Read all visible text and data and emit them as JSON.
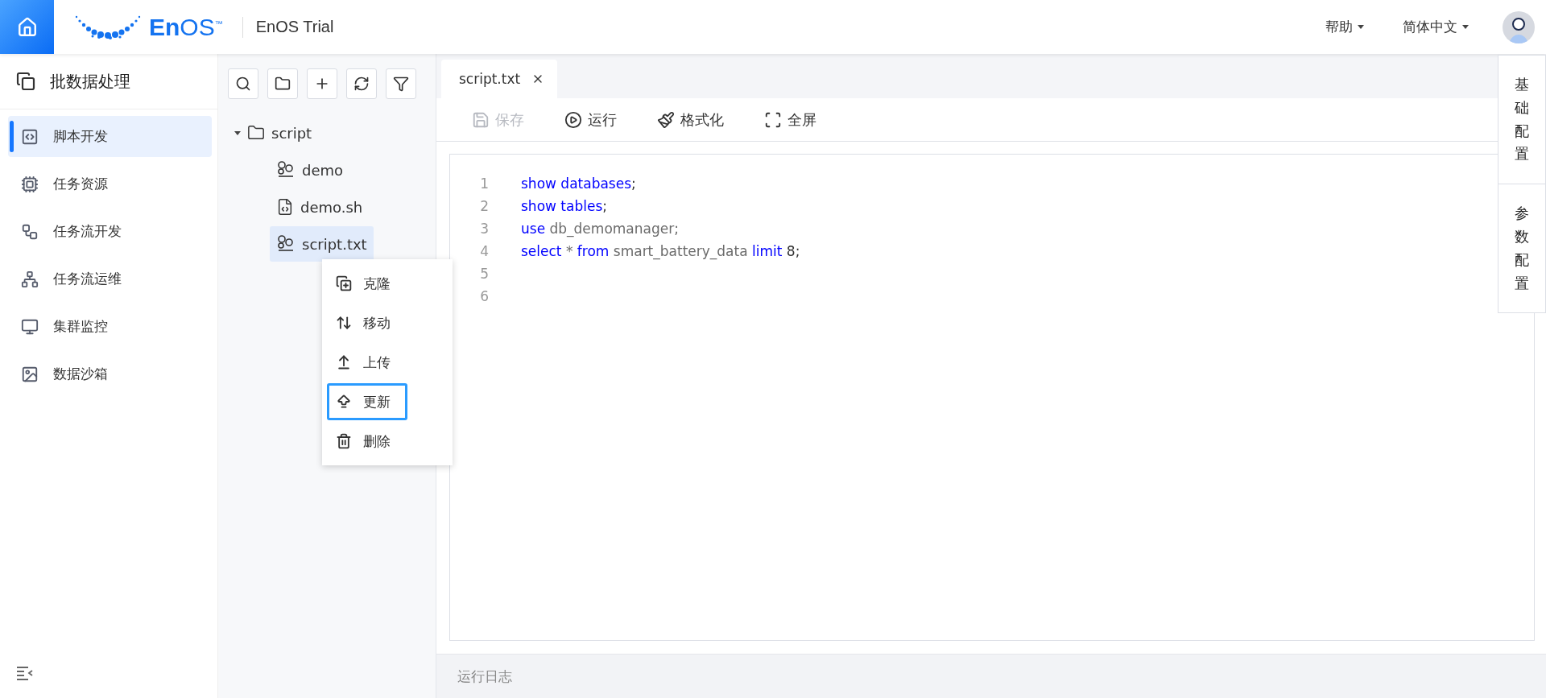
{
  "header": {
    "logo": "**En**OS$^{™}$",
    "app_title": "EnOS Trial",
    "menus": [
      {
        "label": "帮助"
      },
      {
        "label": "简体中文"
      }
    ]
  },
  "sidebar": {
    "title": "批数据处理",
    "items": [
      {
        "label": "脚本开发",
        "selected": true
      },
      {
        "label": "任务资源",
        "selected": false
      },
      {
        "label": "任务流开发",
        "selected": false
      },
      {
        "label": "任务流运维",
        "selected": false
      },
      {
        "label": "集群监控",
        "selected": false
      },
      {
        "label": "数据沙箱",
        "selected": false
      }
    ]
  },
  "file_tree": {
    "items": [
      {
        "label": "script",
        "kind": "folder",
        "expanded": true,
        "selected": false,
        "children": [
          {
            "label": "demo",
            "kind": "hive",
            "selected": false
          },
          {
            "label": "demo.sh",
            "kind": "shell",
            "selected": false
          },
          {
            "label": "script.txt",
            "kind": "hive",
            "selected": true
          }
        ]
      }
    ]
  },
  "context_menu": {
    "items": [
      {
        "label": "克隆",
        "highlighted": false
      },
      {
        "label": "移动",
        "highlighted": false
      },
      {
        "label": "上传",
        "highlighted": false
      },
      {
        "label": "更新",
        "highlighted": true
      },
      {
        "label": "删除",
        "highlighted": false
      }
    ]
  },
  "editor": {
    "tabs": [
      {
        "label": "script.txt",
        "selected": true
      }
    ],
    "toolbar": [
      {
        "label": "保存",
        "disabled": true
      },
      {
        "label": "运行",
        "disabled": false
      },
      {
        "label": "格式化",
        "disabled": false
      },
      {
        "label": "全屏",
        "disabled": false
      }
    ],
    "lines": [
      {
        "number": "1",
        "tokens": [
          {
            "text": "show databases",
            "kind": "keyword"
          },
          {
            "text": ";",
            "kind": "punct"
          }
        ]
      },
      {
        "number": "2",
        "tokens": [
          {
            "text": "show tables",
            "kind": "keyword"
          },
          {
            "text": ";",
            "kind": "punct"
          }
        ]
      },
      {
        "number": "3",
        "tokens": [
          {
            "text": "use",
            "kind": "keyword"
          },
          {
            "text": " db_demomanager;",
            "kind": "ident"
          }
        ]
      },
      {
        "number": "4",
        "tokens": [
          {
            "text": "select",
            "kind": "keyword"
          },
          {
            "text": " * ",
            "kind": "ident"
          },
          {
            "text": "from",
            "kind": "keyword"
          },
          {
            "text": " smart_battery_data ",
            "kind": "ident"
          },
          {
            "text": "limit",
            "kind": "keyword"
          },
          {
            "text": " 8;",
            "kind": "punct"
          }
        ]
      },
      {
        "number": "5"
      },
      {
        "number": "6"
      }
    ],
    "log_label": "运行日志"
  },
  "side_panel": {
    "tabs": [
      {
        "label": "基础配置"
      },
      {
        "label": "参数配置"
      }
    ]
  }
}
